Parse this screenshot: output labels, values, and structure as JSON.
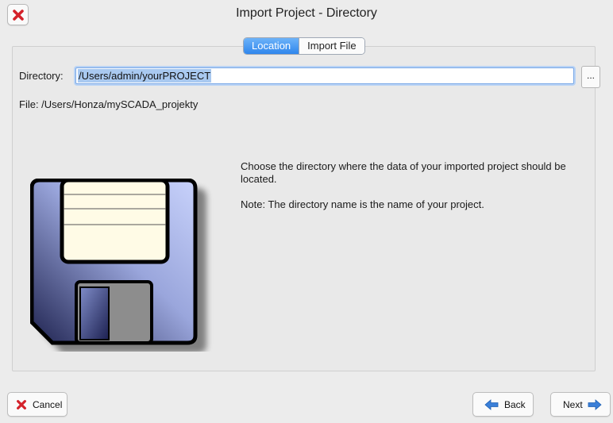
{
  "window": {
    "title": "Import Project - Directory"
  },
  "tabs": [
    {
      "label": "Location",
      "active": true
    },
    {
      "label": "Import File",
      "active": false
    }
  ],
  "directory": {
    "label": "Directory:",
    "value": "/Users/admin/yourPROJECT",
    "browse_label": "..."
  },
  "file_info": "File: /Users/Honza/mySCADA_projekty",
  "description": {
    "line1": "Choose the directory where the data of your imported project should be located.",
    "line2": "Note: The directory name is the name of your project."
  },
  "buttons": {
    "cancel": "Cancel",
    "back": "Back",
    "next": "Next"
  },
  "icons": {
    "close": "close-icon",
    "floppy": "floppy-disk-icon",
    "back": "arrow-left-icon",
    "next": "arrow-right-icon"
  },
  "colors": {
    "accent": "#2f86ec",
    "close_red": "#d4222a"
  }
}
